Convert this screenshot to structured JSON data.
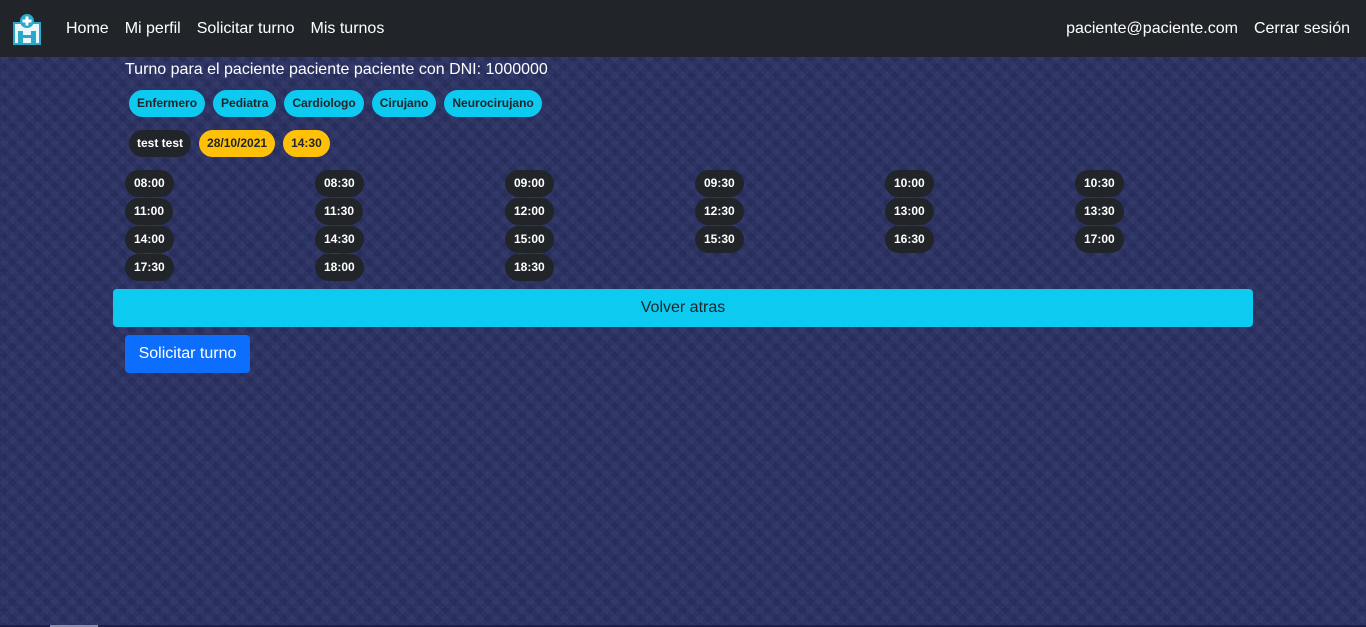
{
  "nav": {
    "logo_icon": "hospital-icon",
    "items": [
      {
        "label": "Home"
      },
      {
        "label": "Mi perfil"
      },
      {
        "label": "Solicitar turno"
      },
      {
        "label": "Mis turnos"
      }
    ],
    "user_email": "paciente@paciente.com",
    "logout_label": "Cerrar sesión"
  },
  "page": {
    "title": "Turno para el paciente paciente paciente con DNI: 1000000"
  },
  "specialties": [
    "Enfermero",
    "Pediatra",
    "Cardiologo",
    "Cirujano",
    "Neurocirujano"
  ],
  "selection": {
    "professional": "test test",
    "date": "28/10/2021",
    "time": "14:30"
  },
  "time_slots": [
    "08:00",
    "08:30",
    "09:00",
    "09:30",
    "10:00",
    "10:30",
    "11:00",
    "11:30",
    "12:00",
    "12:30",
    "13:00",
    "13:30",
    "14:00",
    "14:30",
    "15:00",
    "15:30",
    "16:30",
    "17:00",
    "17:30",
    "18:00",
    "18:30"
  ],
  "buttons": {
    "back_label": "Volver atras",
    "submit_label": "Solicitar turno"
  },
  "colors": {
    "navbar": "#212529",
    "info": "#0dcaf0",
    "warning": "#ffc107",
    "primary": "#0d6efd",
    "background": "#2b3264"
  }
}
